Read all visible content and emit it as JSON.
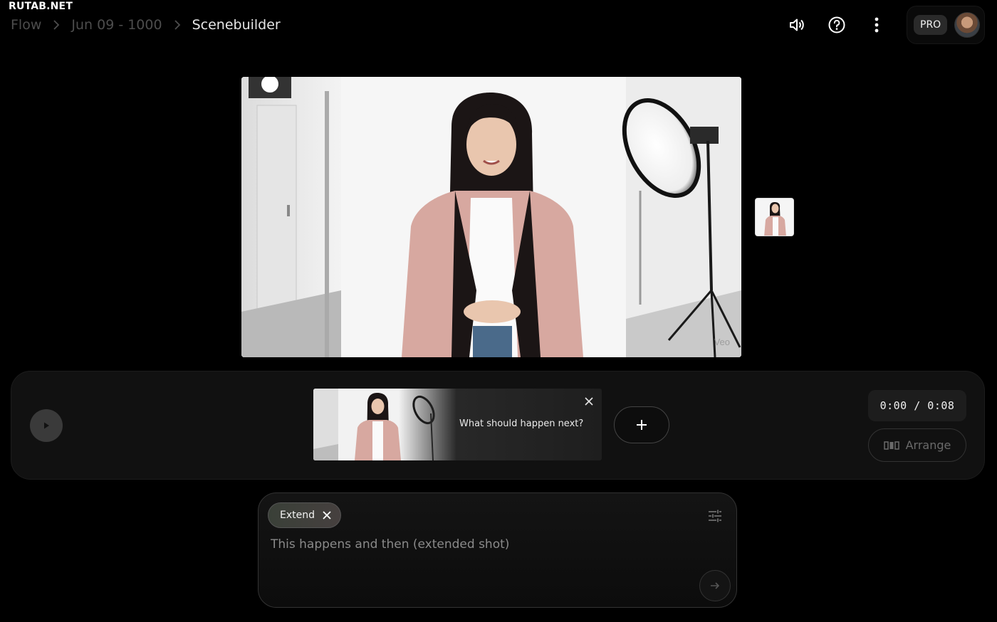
{
  "watermark": "RUTAB.NET",
  "breadcrumb": {
    "root": "Flow",
    "project": "Jun 09 - 1000",
    "current": "Scenebuilder"
  },
  "header": {
    "icons": [
      "volume-icon",
      "help-icon",
      "more-vert-icon"
    ],
    "pro_label": "PRO"
  },
  "player": {
    "watermark": "Veo"
  },
  "timeline": {
    "clip_prompt": "What should happen next?",
    "time": "0:00 / 0:08",
    "arrange_label": "Arrange"
  },
  "composer": {
    "chip_label": "Extend",
    "placeholder": "This happens and then (extended shot)"
  },
  "colors": {
    "background": "#000000",
    "panel": "#111111",
    "chip": "#3f423c"
  }
}
